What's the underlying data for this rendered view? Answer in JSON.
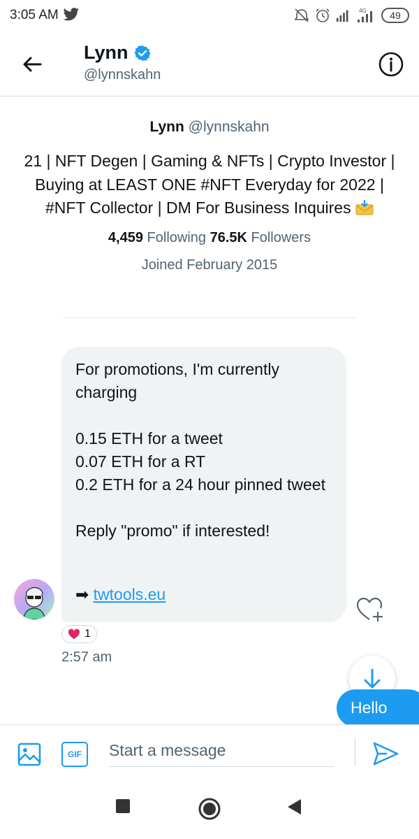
{
  "status_bar": {
    "time": "3:05 AM",
    "network_label": "4G",
    "battery": "49",
    "icons": [
      "twitter-bird-icon",
      "alarm-off-icon",
      "alarm-icon",
      "signal-icon",
      "signal-4g-icon",
      "battery-icon"
    ]
  },
  "header": {
    "name": "Lynn",
    "handle": "@lynnskahn",
    "icons": [
      "back-arrow-icon",
      "verified-badge-icon",
      "info-icon"
    ]
  },
  "profile": {
    "name": "Lynn",
    "handle": "@lynnskahn",
    "bio": "21 | NFT Degen | Gaming & NFTs | Crypto Investor | Buying at LEAST ONE #NFT Everyday for 2022 | #NFT Collector | DM For Business Inquires",
    "following_count": "4,459",
    "following_label": "Following",
    "followers_count": "76.5K",
    "followers_label": "Followers",
    "joined": "Joined February 2015"
  },
  "message": {
    "text": "For promotions, I'm currently charging\n\n0.15 ETH for a tweet\n0.07 ETH for a RT\n0.2 ETH for a 24 hour pinned tweet\n\nReply \"promo\" if interested!",
    "link_prefix": "➡",
    "link_text": "twtools.eu",
    "reaction_count": "1",
    "time": "2:57 am"
  },
  "outgoing": {
    "text": "Hello"
  },
  "composer": {
    "gif_label": "GIF",
    "placeholder": "Start a message"
  },
  "colors": {
    "accent": "#1d9bf0",
    "bubble_bg": "#eff3f4",
    "secondary_text": "#536471",
    "heart": "#e0245e"
  }
}
